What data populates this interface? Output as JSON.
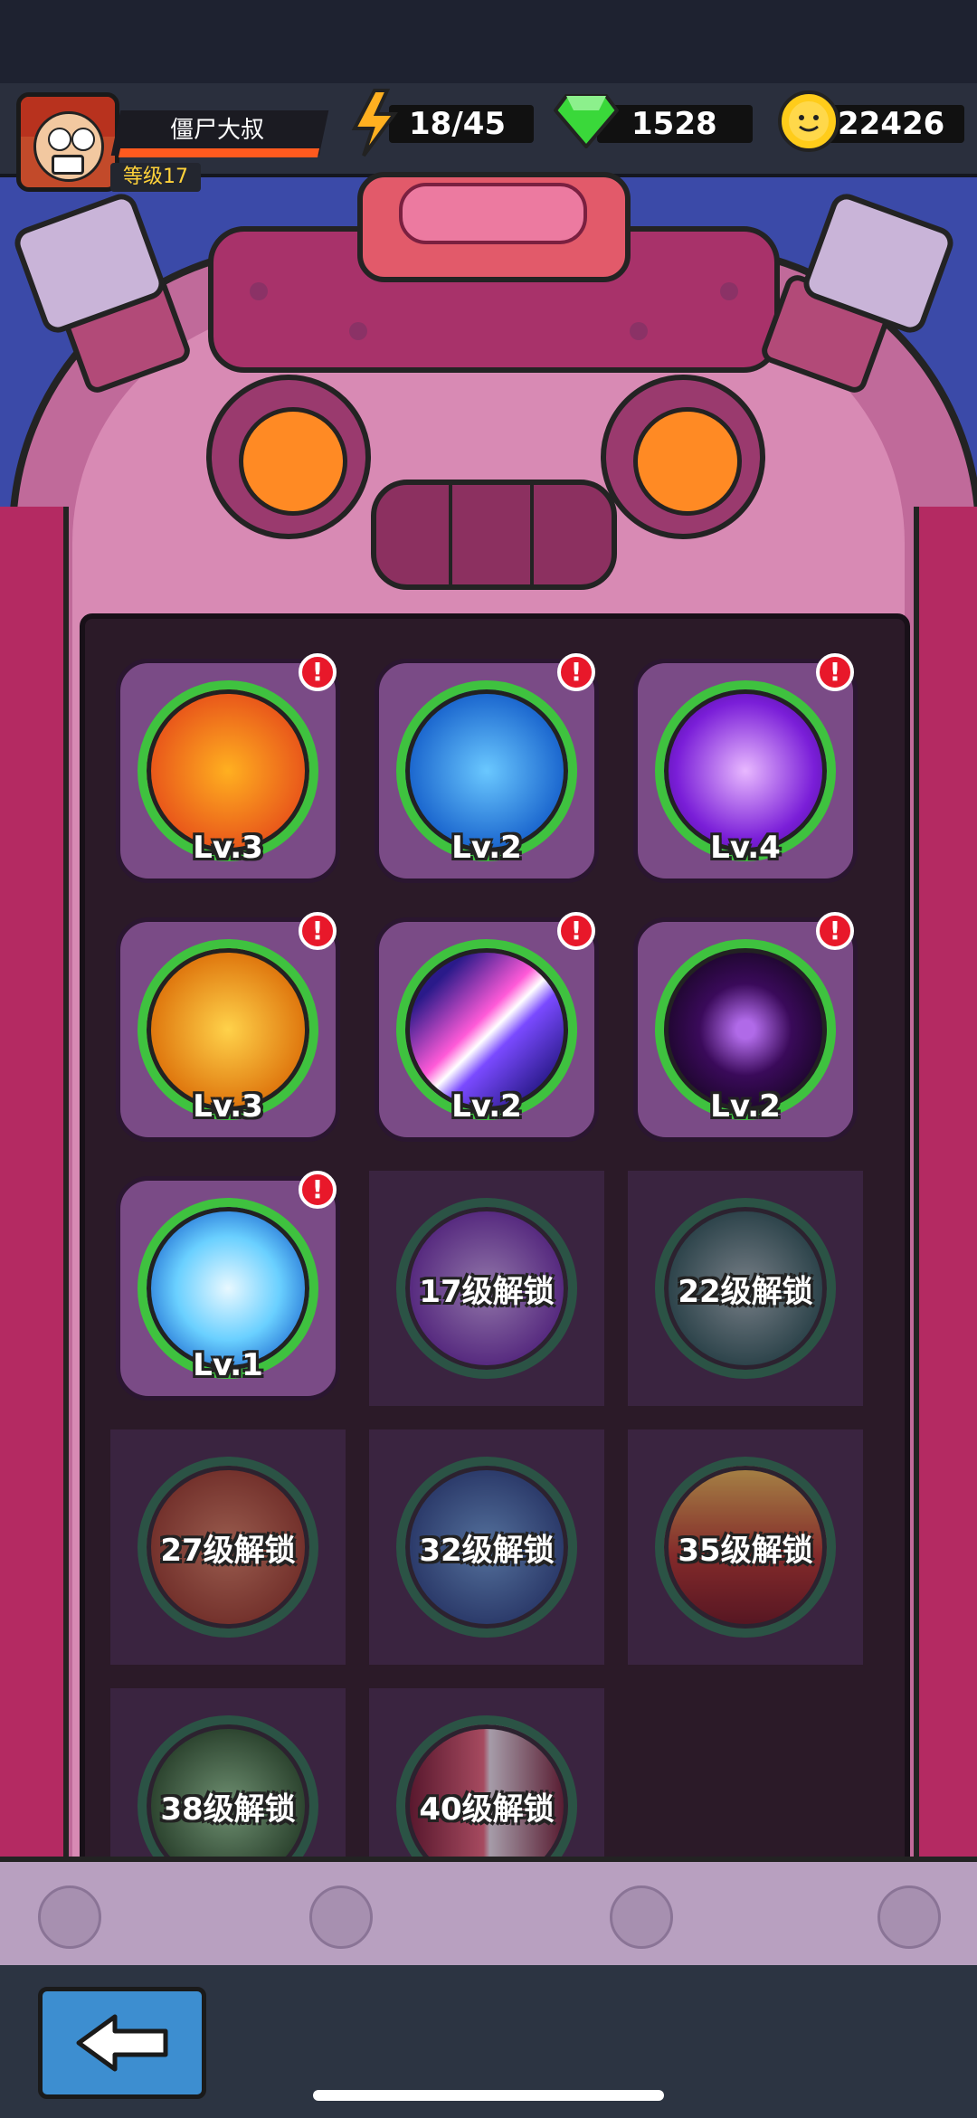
{
  "player": {
    "name": "僵尸大叔",
    "level_label": "等级17"
  },
  "resources": {
    "energy": "18/45",
    "gems": "1528",
    "coins": "22426"
  },
  "skills": [
    {
      "level": "Lv.3",
      "alert": "!",
      "icon": "fire-bullet-icon",
      "color": "#e8541a"
    },
    {
      "level": "Lv.2",
      "alert": "!",
      "icon": "blue-rocket-icon",
      "color": "#1e6ad0"
    },
    {
      "level": "Lv.4",
      "alert": "!",
      "icon": "purple-lightning-icon",
      "color": "#7a1ed8"
    },
    {
      "level": "Lv.3",
      "alert": "!",
      "icon": "battle-car-icon",
      "color": "#e07a10"
    },
    {
      "level": "Lv.2",
      "alert": "!",
      "icon": "laser-slash-icon",
      "color": "#3a2ab8"
    },
    {
      "level": "Lv.2",
      "alert": "!",
      "icon": "black-hole-icon",
      "color": "#3a0a5a"
    },
    {
      "level": "Lv.1",
      "alert": "!",
      "icon": "ice-crystal-icon",
      "color": "#2a9ae8"
    }
  ],
  "locked": [
    {
      "label": "17级解锁",
      "icon": "lightning-bolt-icon",
      "color": "#6a2ab0"
    },
    {
      "label": "22级解锁",
      "icon": "tornado-icon",
      "color": "#1e5a50"
    },
    {
      "label": "27级解锁",
      "icon": "drone-icon",
      "color": "#a03a1a"
    },
    {
      "label": "32级解锁",
      "icon": "water-vortex-icon",
      "color": "#1e4a8a"
    },
    {
      "label": "35级解锁",
      "icon": "fire-wall-icon",
      "color": "#c0301a"
    },
    {
      "label": "38级解锁",
      "icon": "saw-blade-icon",
      "color": "#1e5a1e"
    },
    {
      "label": "40级解锁",
      "icon": "red-beam-icon",
      "color": "#a01a2a"
    }
  ],
  "colors": {
    "accent_green": "#3fc23f",
    "alert_red": "#e8182a",
    "back_button": "#3d8ed0"
  }
}
